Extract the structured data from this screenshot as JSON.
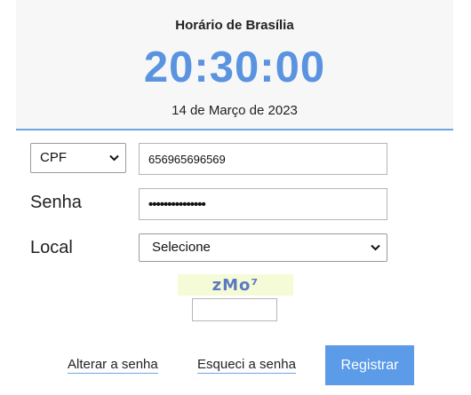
{
  "clock": {
    "title": "Horário de Brasília",
    "time": "20:30:00",
    "date": "14 de Março de 2023"
  },
  "form": {
    "id_type_selected": "CPF",
    "id_value": "656965696569",
    "password_label": "Senha",
    "password_masked": "•••••••••••••••",
    "local_label": "Local",
    "local_selected": "Selecione",
    "captcha_text": "zMo⁷"
  },
  "actions": {
    "change_password": "Alterar a senha",
    "forgot_password": "Esqueci a senha",
    "register": "Registrar"
  },
  "colors": {
    "accent": "#5a93e0",
    "button": "#5b9be8",
    "header_bg": "#f7f7f7",
    "captcha_bg": "#f5fbd7"
  },
  "icons": {
    "dropdown": "chevron-down-icon"
  }
}
